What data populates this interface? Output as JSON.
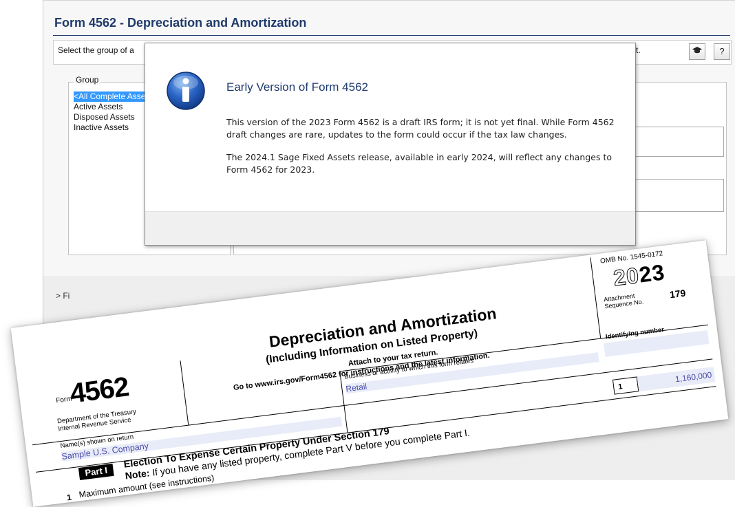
{
  "app": {
    "title": "Form 4562 - Depreciation and Amortization",
    "instruction_start": "Select the group of a",
    "instruction_end": "rt.",
    "help_button": "?",
    "group_label": "Group",
    "groups": [
      "<All Complete Assets>",
      "Active Assets",
      "Disposed Assets",
      "Inactive Assets"
    ],
    "selected_group_index": 0,
    "lower_label": "> Fi"
  },
  "dialog": {
    "icon": "info-icon",
    "title": "Early Version of Form 4562",
    "paragraph1": "This version of the 2023 Form 4562 is a draft IRS form; it is not yet final. While Form 4562 draft changes are rare, updates to the form could occur if the tax law changes.",
    "paragraph2": "The 2024.1 Sage Fixed Assets release, available in early 2024, will reflect any changes to Form 4562 for 2023."
  },
  "form": {
    "form_word": "Form",
    "form_number": "4562",
    "department": [
      "Department of the Treasury",
      "Internal Revenue Service"
    ],
    "title": "Depreciation and Amortization",
    "subtitle": "(Including Information on Listed Property)",
    "attach": "Attach to your tax return.",
    "goto": "Go to www.irs.gov/Form4562 for instructions and the latest information.",
    "omb": "OMB No. 1545-0172",
    "year_prefix": "20",
    "year_suffix": "23",
    "attachment_label": [
      "Attachment",
      "Sequence No."
    ],
    "sequence_no": "179",
    "names_label": "Name(s) shown on return",
    "names_value": "Sample U.S. Company",
    "business_label": "Business or activity to which this form relates",
    "business_value": "Retail",
    "identifying_label": "Identifying number",
    "part_label": "Part I",
    "part_title": "Election To Expense Certain Property Under Section 179",
    "note_bold": "Note:",
    "note_text": " If you have any listed property, complete Part V before you complete Part I.",
    "line1_num": "1",
    "line1_text": "Maximum amount (see instructions)",
    "line1_box": "1",
    "line1_value": "1,160,000"
  }
}
